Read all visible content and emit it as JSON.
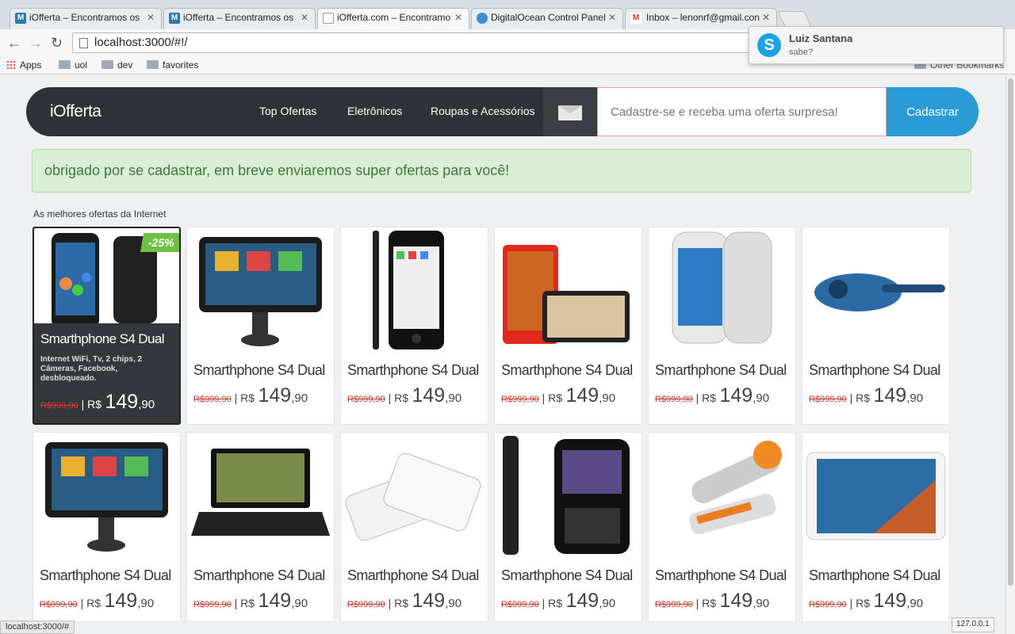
{
  "browser": {
    "tabs": [
      {
        "title": "iOfferta – Encontramos os",
        "favicon": "M",
        "active": false
      },
      {
        "title": "iOfferta – Encontramos os",
        "favicon": "M",
        "active": false
      },
      {
        "title": "iOfferta.com – Encontramo",
        "favicon": "",
        "active": true
      },
      {
        "title": "DigitalOcean Control Panel",
        "favicon": "",
        "active": false
      },
      {
        "title": "Inbox – lenonrf@gmail.con",
        "favicon": "M",
        "active": false
      }
    ],
    "url": "localhost:3000/#!/",
    "bookmarks": [
      "Apps",
      "uol",
      "dev",
      "favorites"
    ],
    "other_bookmarks": "Other Bookmarks",
    "status_url": "localhost:3000/#",
    "ip_label": "127.0.0.1"
  },
  "notification": {
    "name": "Luiz Santana",
    "message": "sabe?"
  },
  "header": {
    "logo": "iOfferta",
    "nav": [
      "Top Ofertas",
      "Eletrônicos",
      "Roupas e Acessórios"
    ],
    "signup_placeholder": "Cadastre-se e receba uma oferta surpresa!",
    "signup_button": "Cadastrar"
  },
  "alert": "obrigado por se cadastrar, em breve enviaremos super ofertas para você!",
  "section_title": "As melhores ofertas da Internet",
  "products": [
    {
      "name": "Smarthphone S4 Dual",
      "old": "R$999,90",
      "currency": "R$",
      "price": "149",
      "cents": ",90",
      "badge": "-25%",
      "desc": "Internet WiFi, Tv, 2 chips, 2 Câmeras, Facebook, desbloqueado.",
      "icon": "phone-galaxy-icon"
    },
    {
      "name": "Smarthphone S4 Dual",
      "old": "R$999,90",
      "currency": "R$",
      "price": "149",
      "cents": ",90",
      "icon": "gps-device-icon"
    },
    {
      "name": "Smarthphone S4 Dual",
      "old": "R$999,90",
      "currency": "R$",
      "price": "149",
      "cents": ",90",
      "icon": "iphone-icon"
    },
    {
      "name": "Smarthphone S4 Dual",
      "old": "R$999,90",
      "currency": "R$",
      "price": "149",
      "cents": ",90",
      "icon": "lumia-phone-icon"
    },
    {
      "name": "Smarthphone S4 Dual",
      "old": "R$999,90",
      "currency": "R$",
      "price": "149",
      "cents": ",90",
      "icon": "galaxy-s3-icon"
    },
    {
      "name": "Smarthphone S4 Dual",
      "old": "R$999,90",
      "currency": "R$",
      "price": "149",
      "cents": ",90",
      "icon": "hair-curler-icon"
    },
    {
      "name": "Smarthphone S4 Dual",
      "old": "R$999,90",
      "currency": "R$",
      "price": "149",
      "cents": ",90",
      "icon": "gps-device-icon"
    },
    {
      "name": "Smarthphone S4 Dual",
      "old": "R$999,90",
      "currency": "R$",
      "price": "149",
      "cents": ",90",
      "icon": "netbook-icon"
    },
    {
      "name": "Smarthphone S4 Dual",
      "old": "R$999,90",
      "currency": "R$",
      "price": "149",
      "cents": ",90",
      "icon": "white-iphone-icon"
    },
    {
      "name": "Smarthphone S4 Dual",
      "old": "R$999,90",
      "currency": "R$",
      "price": "149",
      "cents": ",90",
      "icon": "blackberry-icon"
    },
    {
      "name": "Smarthphone S4 Dual",
      "old": "R$999,90",
      "currency": "R$",
      "price": "149",
      "cents": ",90",
      "icon": "hair-straightener-icon"
    },
    {
      "name": "Smarthphone S4 Dual",
      "old": "R$999,90",
      "currency": "R$",
      "price": "149",
      "cents": ",90",
      "icon": "tablet-icon"
    }
  ],
  "colors": {
    "header": "#2f3337",
    "accent": "#2b9bd6",
    "alert_bg": "#d9eed4",
    "badge": "#6fc146"
  }
}
